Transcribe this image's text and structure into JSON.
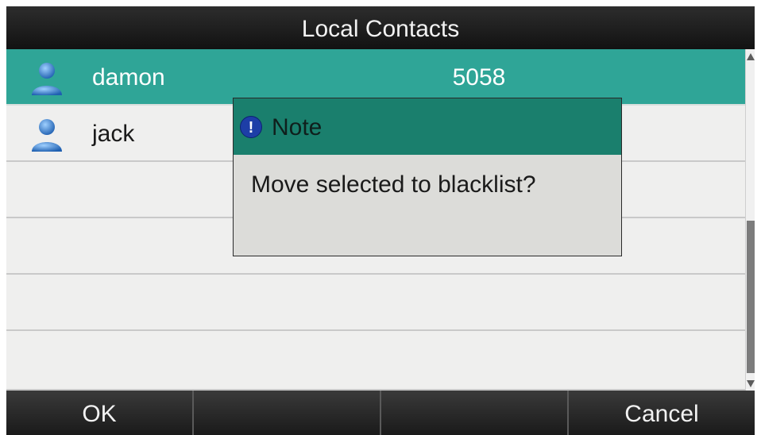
{
  "header": {
    "title": "Local Contacts"
  },
  "contacts": [
    {
      "name": "damon",
      "number": "5058",
      "selected": true
    },
    {
      "name": "jack",
      "number": "",
      "selected": false
    }
  ],
  "dialog": {
    "title": "Note",
    "icon_glyph": "!",
    "message": "Move selected to blacklist?"
  },
  "softkeys": [
    "OK",
    "",
    "",
    "Cancel"
  ],
  "colors": {
    "accent": "#2fa597",
    "dialog_header": "#1a7f6d",
    "note_icon": "#1d3ea7"
  },
  "icons": {
    "contact": "contact-person-icon",
    "note": "info-exclamation-icon"
  }
}
